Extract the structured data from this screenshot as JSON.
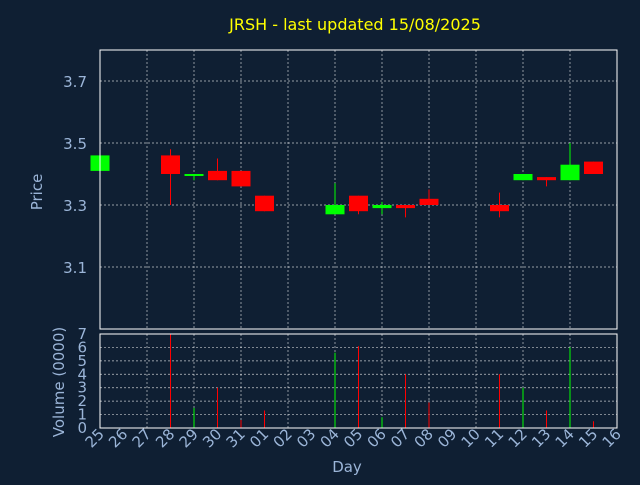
{
  "colors": {
    "background": "#0f1f33",
    "title": "#ffff00",
    "axis_text": "#9bb5d8",
    "up": "#00ff00",
    "down": "#ff0000",
    "grid": "#ffffff",
    "frame": "#ffffff"
  },
  "chart_data": {
    "type": "candlestick",
    "title": "JRSH - last updated 15/08/2025",
    "xlabel": "Day",
    "ylabel": "Price",
    "volume_label": "Volume (0000)",
    "price_ylim": [
      2.9,
      3.8
    ],
    "price_ticks": [
      "3.1",
      "3.3",
      "3.5",
      "3.7"
    ],
    "price_tick_values": [
      3.1,
      3.3,
      3.5,
      3.7
    ],
    "volume_ylim": [
      0,
      7
    ],
    "volume_ticks": [
      "0",
      "1",
      "2",
      "3",
      "4",
      "5",
      "6",
      "7"
    ],
    "volume_tick_values": [
      0,
      1,
      2,
      3,
      4,
      5,
      6,
      7
    ],
    "grid": true,
    "days": [
      "25",
      "26",
      "27",
      "28",
      "29",
      "30",
      "31",
      "01",
      "02",
      "03",
      "04",
      "05",
      "06",
      "07",
      "08",
      "09",
      "10",
      "11",
      "12",
      "13",
      "14",
      "15",
      "16"
    ],
    "candles": [
      {
        "day": "25",
        "open": 3.41,
        "high": 3.46,
        "low": 3.41,
        "close": 3.46,
        "volume": 0
      },
      {
        "day": "28",
        "open": 3.46,
        "high": 3.48,
        "low": 3.3,
        "close": 3.4,
        "volume": 7.0
      },
      {
        "day": "29",
        "open": 3.4,
        "high": 3.4,
        "low": 3.38,
        "close": 3.4,
        "volume": 1.5
      },
      {
        "day": "30",
        "open": 3.41,
        "high": 3.45,
        "low": 3.38,
        "close": 3.38,
        "volume": 3.0
      },
      {
        "day": "31",
        "open": 3.41,
        "high": 3.41,
        "low": 3.36,
        "close": 3.36,
        "volume": 0.6
      },
      {
        "day": "01",
        "open": 3.33,
        "high": 3.33,
        "low": 3.28,
        "close": 3.28,
        "volume": 1.3
      },
      {
        "day": "04",
        "open": 3.27,
        "high": 3.37,
        "low": 3.27,
        "close": 3.3,
        "volume": 5.6
      },
      {
        "day": "05",
        "open": 3.33,
        "high": 3.33,
        "low": 3.27,
        "close": 3.28,
        "volume": 6.1
      },
      {
        "day": "06",
        "open": 3.29,
        "high": 3.31,
        "low": 3.27,
        "close": 3.3,
        "volume": 0.8
      },
      {
        "day": "07",
        "open": 3.3,
        "high": 3.3,
        "low": 3.26,
        "close": 3.29,
        "volume": 4.0
      },
      {
        "day": "08",
        "open": 3.32,
        "high": 3.35,
        "low": 3.3,
        "close": 3.3,
        "volume": 1.9
      },
      {
        "day": "11",
        "open": 3.3,
        "high": 3.34,
        "low": 3.26,
        "close": 3.28,
        "volume": 4.0
      },
      {
        "day": "12",
        "open": 3.38,
        "high": 3.4,
        "low": 3.38,
        "close": 3.4,
        "volume": 3.0
      },
      {
        "day": "13",
        "open": 3.39,
        "high": 3.39,
        "low": 3.36,
        "close": 3.38,
        "volume": 1.3
      },
      {
        "day": "14",
        "open": 3.38,
        "high": 3.5,
        "low": 3.38,
        "close": 3.43,
        "volume": 6.0
      },
      {
        "day": "15",
        "open": 3.44,
        "high": 3.44,
        "low": 3.4,
        "close": 3.4,
        "volume": 0.5
      }
    ]
  }
}
